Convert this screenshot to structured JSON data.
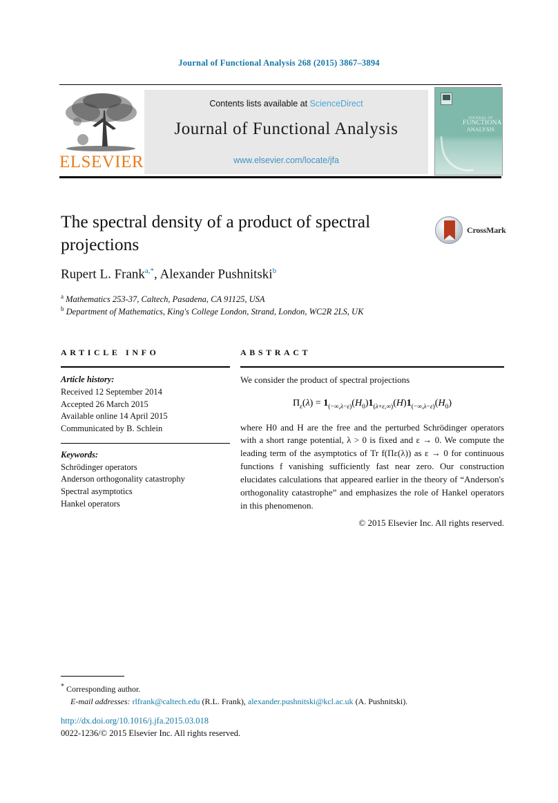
{
  "running_head": "Journal of Functional Analysis 268 (2015) 3867–3894",
  "masthead": {
    "publisher_name": "ELSEVIER",
    "publisher_logo_alt": "elsevier-tree-logo",
    "contents_prefix": "Contents lists available at ",
    "contents_link": "ScienceDirect",
    "journal_title": "Journal of Functional Analysis",
    "journal_url": "www.elsevier.com/locate/jfa",
    "cover": {
      "line1": "JOURNAL OF",
      "line2": "FUNCTIONAL",
      "line3": "ANALYSIS"
    },
    "colors": {
      "link_blue": "#4aa3d8",
      "cover_teal": "#7fb9ab",
      "elsevier_orange": "#E87C1E"
    }
  },
  "article": {
    "title": "The spectral density of a product of spectral projections",
    "crossmark_label": "CrossMark",
    "authors_text": "Rupert L. Frank",
    "author1_sup": "a,",
    "author1_star": "*",
    "authors_text2": ", Alexander Pushnitski",
    "author2_sup": "b",
    "affiliation_a_marker": "a",
    "affiliation_a": "Mathematics 253-37, Caltech, Pasadena, CA 91125, USA",
    "affiliation_b_marker": "b",
    "affiliation_b": "Department of Mathematics, King's College London, Strand, London, WC2R 2LS, UK"
  },
  "article_info": {
    "heading": "ARTICLE INFO",
    "history_label": "Article history:",
    "history": [
      "Received 12 September 2014",
      "Accepted 26 March 2015",
      "Available online 14 April 2015",
      "Communicated by B. Schlein"
    ],
    "keywords_label": "Keywords:",
    "keywords": [
      "Schrödinger operators",
      "Anderson orthogonality catastrophy",
      "Spectral asymptotics",
      "Hankel operators"
    ]
  },
  "abstract": {
    "heading": "ABSTRACT",
    "intro": "We consider the product of spectral projections",
    "formula_plain": "Πε(λ) = 1(−∞,λ−ε)(H0)1(λ+ε,∞)(H)1(−∞,λ−ε)(H0)",
    "body": "where H0 and H are the free and the perturbed Schrödinger operators with a short range potential, λ > 0 is fixed and ε → 0. We compute the leading term of the asymptotics of Tr f(Πε(λ)) as ε → 0 for continuous functions f vanishing sufficiently fast near zero. Our construction elucidates calculations that appeared earlier in the theory of “Anderson's orthogonality catastrophe” and emphasizes the role of Hankel operators in this phenomenon.",
    "copyright": "© 2015 Elsevier Inc. All rights reserved."
  },
  "footer": {
    "corresponding_marker": "*",
    "corresponding_text": "Corresponding author.",
    "email_label": "E-mail addresses:",
    "email1": "rlfrank@caltech.edu",
    "email1_owner": "(R.L. Frank),",
    "email2": "alexander.pushnitski@kcl.ac.uk",
    "email2_owner": "(A. Pushnitski).",
    "doi": "http://dx.doi.org/10.1016/j.jfa.2015.03.018",
    "issn_prefix": "0022-1236/",
    "issn_rest": "© 2015 Elsevier Inc. All rights reserved."
  }
}
